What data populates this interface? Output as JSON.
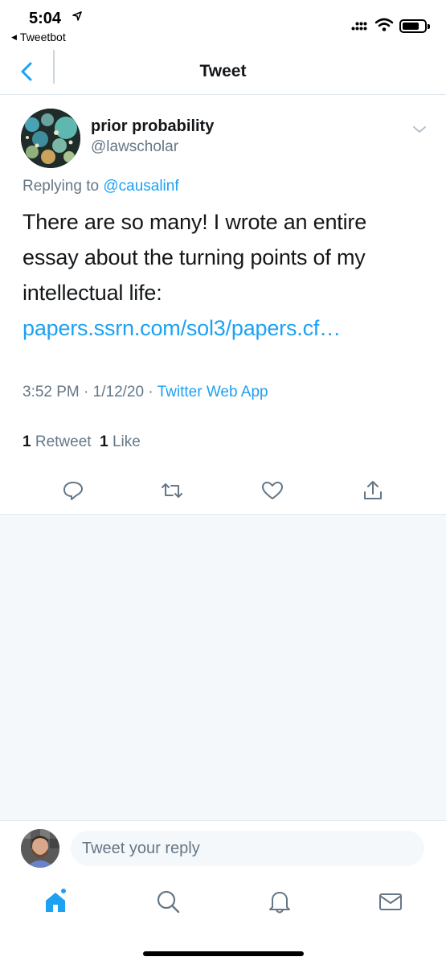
{
  "status_bar": {
    "time": "5:04",
    "back_app": "Tweetbot"
  },
  "nav": {
    "title": "Tweet"
  },
  "tweet": {
    "display_name": "prior probability",
    "handle": "@lawscholar",
    "replying_prefix": "Replying to ",
    "replying_to": "@causalinf",
    "text": "There are so many! I wrote an entire essay about the turning points of my intellectual life: ",
    "link": "papers.ssrn.com/sol3/papers.cf…",
    "time": "3:52 PM",
    "separator": " · ",
    "date": "1/12/20",
    "source": "Twitter Web App",
    "retweet_count": "1",
    "retweet_label": " Retweet",
    "like_count": "1",
    "like_label": " Like"
  },
  "reply": {
    "placeholder": "Tweet your reply"
  },
  "icons": {
    "accent": "#1da1f2",
    "gray": "#657786",
    "actions": [
      "reply-icon",
      "retweet-icon",
      "like-icon",
      "share-icon"
    ],
    "tabs": [
      "home-icon",
      "search-icon",
      "notifications-icon",
      "messages-icon"
    ]
  }
}
